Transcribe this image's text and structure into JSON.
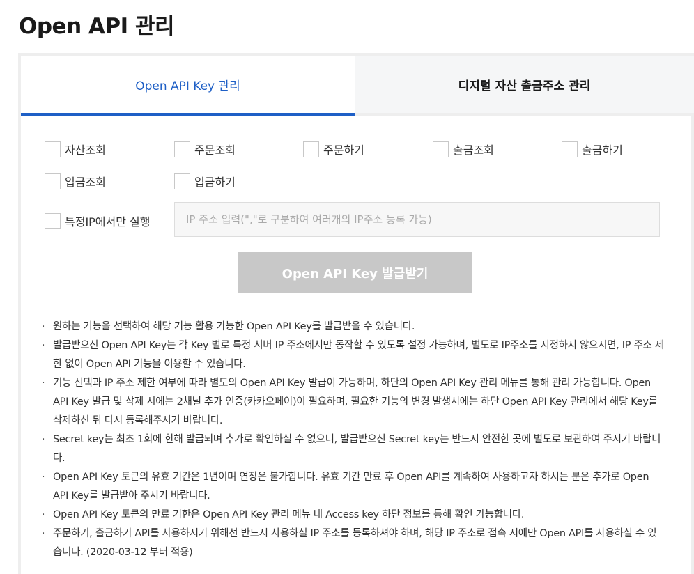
{
  "page": {
    "title": "Open API 관리"
  },
  "tabs": [
    {
      "label": "Open API Key 관리",
      "active": true
    },
    {
      "label": "디지털 자산 출금주소 관리",
      "active": false
    }
  ],
  "permissions": [
    {
      "label": "자산조회",
      "checked": false
    },
    {
      "label": "주문조회",
      "checked": false
    },
    {
      "label": "주문하기",
      "checked": false
    },
    {
      "label": "출금조회",
      "checked": false
    },
    {
      "label": "출금하기",
      "checked": false
    },
    {
      "label": "입금조회",
      "checked": false
    },
    {
      "label": "입금하기",
      "checked": false
    }
  ],
  "ip_restriction": {
    "label": "특정IP에서만 실행",
    "checked": false,
    "input_value": "",
    "placeholder": "IP 주소 입력(\",\"로 구분하여 여러개의 IP주소 등록 가능)"
  },
  "issue_button": {
    "label": "Open API Key 발급받기",
    "enabled": false
  },
  "notes": [
    "원하는 기능을 선택하여 해당 기능 활용 가능한 Open API Key를 발급받을 수 있습니다.",
    "발급받으신 Open API Key는 각 Key 별로 특정 서버 IP 주소에서만 동작할 수 있도록 설정 가능하며, 별도로 IP주소를 지정하지 않으시면, IP 주소 제한 없이 Open API 기능을 이용할 수 있습니다.",
    "기능 선택과 IP 주소 제한 여부에 따라 별도의 Open API Key 발급이 가능하며, 하단의 Open API Key 관리 메뉴를 통해 관리 가능합니다. Open API Key 발급 및 삭제 시에는 2채널 추가 인증(카카오페이)이 필요하며, 필요한 기능의 변경 발생시에는 하단 Open API Key 관리에서 해당 Key를 삭제하신 뒤 다시 등록해주시기 바랍니다.",
    "Secret key는 최초 1회에 한해 발급되며 추가로 확인하실 수 없으니, 발급받으신 Secret key는 반드시 안전한 곳에 별도로 보관하여 주시기 바랍니다.",
    "Open API Key 토큰의 유효 기간은 1년이며 연장은 불가합니다. 유효 기간 만료 후 Open API를 계속하여 사용하고자 하시는 분은 추가로 Open API Key를 발급받아 주시기 바랍니다.",
    "Open API Key 토큰의 만료 기한은 Open API Key 관리 메뉴 내 Access key 하단 정보를 통해 확인 가능합니다.",
    "주문하기, 출금하기 API를 사용하시기 위해선 반드시 사용하실 IP 주소를 등록하셔야 하며, 해당 IP 주소로 접속 시에만 Open API를 사용하실 수 있습니다. (2020-03-12 부터 적용)"
  ],
  "colors": {
    "accent": "#1e5fc6",
    "inactive_tab_bg": "#f5f6f7",
    "disabled_button": "#c8c8c8",
    "input_bg": "#f7f7f7"
  }
}
